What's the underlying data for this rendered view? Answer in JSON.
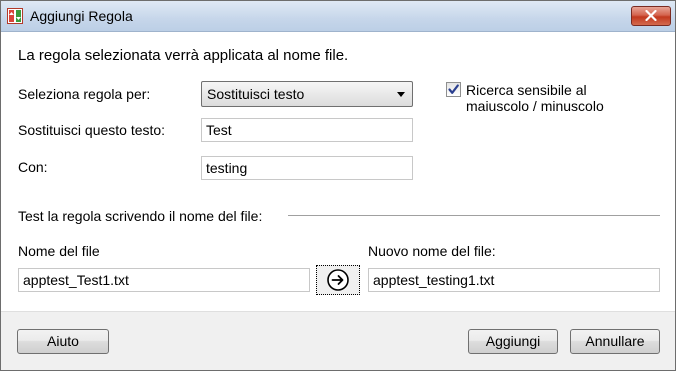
{
  "window": {
    "title": "Aggiungi Regola"
  },
  "intro_text": "La regola selezionata verrà applicata al nome file.",
  "rule": {
    "select_label": "Seleziona regola per:",
    "select_value": "Sostituisci testo",
    "replace_label": "Sostituisci questo testo:",
    "replace_value": "Test",
    "with_label": "Con:",
    "with_value": "testing",
    "case_sensitive_line1": "Ricerca sensibile al",
    "case_sensitive_line2": "maiuscolo / minuscolo",
    "case_sensitive_checked": true
  },
  "test": {
    "section_label": "Test la regola scrivendo il nome del file:",
    "filename_label": "Nome del file",
    "filename_value": "apptest_Test1.txt",
    "new_filename_label": "Nuovo nome del file:",
    "new_filename_value": "apptest_testing1.txt"
  },
  "footer": {
    "help_label": "Aiuto",
    "add_label": "Aggiungi",
    "cancel_label": "Annullare"
  },
  "icons": {
    "app": "app-icon",
    "close": "close-icon",
    "arrow": "arrow-right-circle-icon",
    "check": "checkmark-icon",
    "dropdown": "chevron-down-icon"
  },
  "colors": {
    "titlebar": "#c6d6ea",
    "close_button": "#c2391f",
    "checkmark": "#2a3f8f"
  }
}
